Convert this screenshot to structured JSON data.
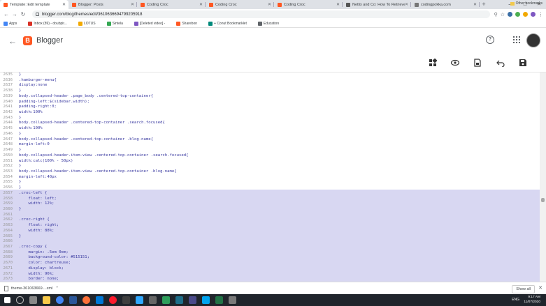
{
  "browser": {
    "tabs": [
      {
        "title": "Template: Edit template",
        "color": "#ff5722",
        "active": true
      },
      {
        "title": "Blogger: Posts",
        "color": "#ff5722"
      },
      {
        "title": "Coding Croc",
        "color": "#ff5722"
      },
      {
        "title": "Coding Croc",
        "color": "#ff5722"
      },
      {
        "title": "Coding Croc",
        "color": "#ff5722"
      },
      {
        "title": "Netlix and Co: How To Retrieve ...",
        "color": "#555555"
      },
      {
        "title": "codingpokka.com",
        "color": "#777777"
      }
    ],
    "url": "blogger.com/blog/themes/edit/3610636694799205918",
    "bookmarks": [
      "Apps",
      "Inbox (89) - doubpir...",
      "LOTUS",
      "Sintela",
      "[Deleted video] -",
      "Sharebon",
      "+ Conut Bookmarklet",
      "Education"
    ],
    "other_bookmarks": "Other bookmarks"
  },
  "blogger": {
    "logo_letter": "B",
    "title": "Blogger",
    "help": "?"
  },
  "editor": {
    "lines": [
      {
        "n": "2635",
        "t": "}"
      },
      {
        "n": "2636",
        "t": ".hamburger-menu{"
      },
      {
        "n": "2637",
        "t": "display:none"
      },
      {
        "n": "2638",
        "t": "}"
      },
      {
        "n": "2639",
        "t": "body.collapsed-header .page_body .centered-top-container{"
      },
      {
        "n": "2640",
        "t": "padding-left:$(sidebar.width);"
      },
      {
        "n": "2641",
        "t": "padding-right:0;"
      },
      {
        "n": "2642",
        "t": "width:100%"
      },
      {
        "n": "2643",
        "t": "}"
      },
      {
        "n": "2644",
        "t": "body.collapsed-header .centered-top-container .search.focused{"
      },
      {
        "n": "2645",
        "t": "width:100%"
      },
      {
        "n": "2646",
        "t": "}"
      },
      {
        "n": "2647",
        "t": "body.collapsed-header .centered-top-container .blog-name{"
      },
      {
        "n": "2648",
        "t": "margin-left:0"
      },
      {
        "n": "2649",
        "t": "}"
      },
      {
        "n": "2650",
        "t": "body.collapsed-header.item-view .centered-top-container .search.focused{"
      },
      {
        "n": "2651",
        "t": "width:calc(100% - 50px)"
      },
      {
        "n": "2652",
        "t": "}"
      },
      {
        "n": "2653",
        "t": "body.collapsed-header.item-view .centered-top-container .blog-name{"
      },
      {
        "n": "2654",
        "t": "margin-left:40px"
      },
      {
        "n": "2655",
        "t": "}"
      },
      {
        "n": "2656",
        "t": "}"
      },
      {
        "n": "2657",
        "t": ".croc-left {"
      },
      {
        "n": "2658",
        "t": "    float: left;"
      },
      {
        "n": "2659",
        "t": "    width: 12%;"
      },
      {
        "n": "2660",
        "t": "}"
      },
      {
        "n": "2661",
        "t": ""
      },
      {
        "n": "2662",
        "t": ".croc-right {"
      },
      {
        "n": "2663",
        "t": "    float: right;"
      },
      {
        "n": "2664",
        "t": "    width: 88%;"
      },
      {
        "n": "2665",
        "t": "}"
      },
      {
        "n": "2666",
        "t": ""
      },
      {
        "n": "2667",
        "t": ".croc-copy {"
      },
      {
        "n": "2668",
        "t": "    margin: .5em 0em;"
      },
      {
        "n": "2669",
        "t": "    background-color: #515151;"
      },
      {
        "n": "2670",
        "t": "    color: chartreuse;"
      },
      {
        "n": "2671",
        "t": "    display: block;"
      },
      {
        "n": "2672",
        "t": "    width: 96%;"
      },
      {
        "n": "2673",
        "t": "    border: none;"
      }
    ]
  },
  "downloads": {
    "file": "theme-361063669....xml",
    "show_all": "Show all"
  },
  "taskbar": {
    "lang": "ENG",
    "time": "9:17 AM",
    "date": "11/07/2020"
  }
}
